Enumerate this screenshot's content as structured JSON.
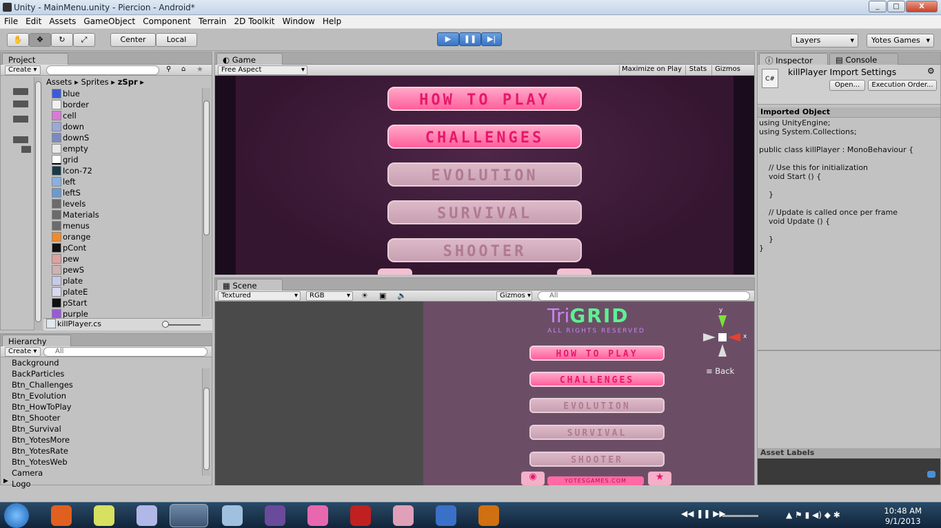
{
  "window": {
    "title": "Unity - MainMenu.unity - Piercion - Android*",
    "min": "_",
    "max": "□",
    "close": "X"
  },
  "menu": [
    "File",
    "Edit",
    "Assets",
    "GameObject",
    "Component",
    "Terrain",
    "2D Toolkit",
    "Window",
    "Help"
  ],
  "toolbar": {
    "center": "Center",
    "local": "Local",
    "layers": "Layers",
    "account": "Yotes Games"
  },
  "project": {
    "tab": "Project",
    "create": "Create",
    "breadcrumb": [
      "Assets",
      "Sprites",
      "zSpr"
    ],
    "items": [
      "blue",
      "border",
      "cell",
      "down",
      "downS",
      "empty",
      "grid",
      "Icon-72",
      "left",
      "leftS",
      "levels",
      "Materials",
      "menus",
      "orange",
      "pCont",
      "pew",
      "pewS",
      "plate",
      "plateE",
      "pStart",
      "purple"
    ],
    "selected": "killPlayer.cs"
  },
  "hierarchy": {
    "tab": "Hierarchy",
    "create": "Create",
    "search": "All",
    "items": [
      "Background",
      "BackParticles",
      "Btn_Challenges",
      "Btn_Evolution",
      "Btn_HowToPlay",
      "Btn_Shooter",
      "Btn_Survival",
      "Btn_YotesMore",
      "Btn_YotesRate",
      "Btn_YotesWeb",
      "Camera",
      "Logo"
    ]
  },
  "game": {
    "tab": "Game",
    "aspect": "Free Aspect",
    "maximize": "Maximize on Play",
    "stats": "Stats",
    "gizmos": "Gizmos",
    "buttons": [
      "HOW TO PLAY",
      "CHALLENGES",
      "EVOLUTION",
      "SURVIVAL",
      "SHOOTER"
    ]
  },
  "scene": {
    "tab": "Scene",
    "mode": "Textured",
    "channel": "RGB",
    "gizmos": "Gizmos",
    "search": "All",
    "logo_tri": "Tri",
    "logo_grid": "GRID",
    "rights": "ALL RIGHTS RESERVED",
    "website": "YOTESGAMES.COM",
    "buttons": [
      "HOW TO PLAY",
      "CHALLENGES",
      "EVOLUTION",
      "SURVIVAL",
      "SHOOTER"
    ],
    "gizmo_y": "y",
    "gizmo_x": "x",
    "back": "Back"
  },
  "inspector": {
    "tab": "Inspector",
    "console": "Console",
    "title": "killPlayer Import Settings",
    "open": "Open...",
    "exec": "Execution Order...",
    "imported": "Imported Object",
    "code": "using UnityEngine;\nusing System.Collections;\n\npublic class killPlayer : MonoBehaviour {\n\n    // Use this for initialization\n    void Start () {\n\n    }\n\n    // Update is called once per frame\n    void Update () {\n\n    }\n}",
    "asset_labels": "Asset Labels"
  },
  "taskbar": {
    "time": "10:48 AM",
    "date": "9/1/2013"
  },
  "colors": {
    "hot": "#ff5f9c",
    "cold": "#c7a0b1",
    "game_bg": "#3a1a36"
  }
}
